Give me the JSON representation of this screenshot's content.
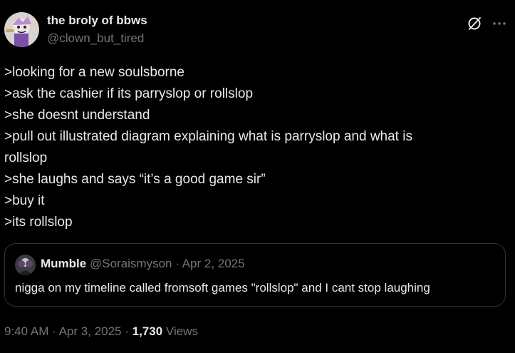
{
  "tweet": {
    "author": {
      "display_name": "the broly of bbws",
      "handle": "@clown_but_tired",
      "avatar_icon": "cartoon-avatar-icon"
    },
    "actions": {
      "grok_icon": "grok-icon",
      "more_icon": "more-options-icon"
    },
    "text_lines": [
      ">looking for a new soulsborne",
      ">ask the cashier if its parryslop or rollslop",
      ">she doesnt understand",
      ">pull out illustrated diagram explaining what is parryslop and what is",
      "rollslop",
      ">she laughs and says “it’s a good game sir”",
      ">buy it",
      ">its rollslop"
    ],
    "quote": {
      "display_name": "Mumble",
      "handle": "@Soraismyson",
      "separator": "·",
      "date": "Apr 2, 2025",
      "text": "nigga on my timeline called fromsoft games \"rollslop\" and I cant stop laughing"
    },
    "footer": {
      "time": "9:40 AM",
      "separator": "·",
      "date": "Apr 3, 2025",
      "views_count": "1,730",
      "views_label": "Views"
    }
  },
  "colors": {
    "background": "#000000",
    "primary_text": "#e7e9ea",
    "secondary_text": "#71767b",
    "border": "#2f3336"
  }
}
